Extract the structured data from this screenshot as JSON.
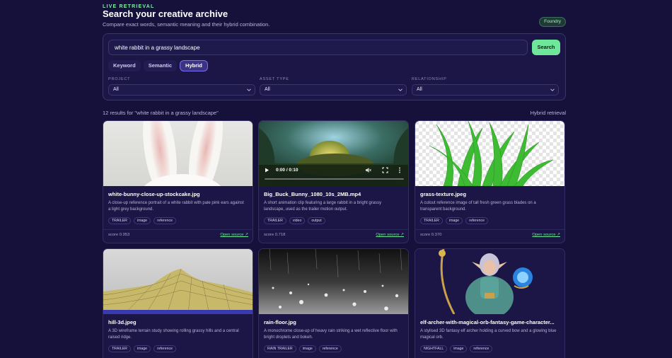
{
  "header": {
    "eyebrow": "LIVE RETRIEVAL",
    "title": "Search your creative archive",
    "subtitle": "Compare exact words, semantic meaning and their hybrid combination.",
    "badge": "Foundry"
  },
  "search": {
    "value": "white rabbit in a grassy landscape",
    "button": "Search"
  },
  "modes": [
    {
      "label": "Keyword",
      "active": false
    },
    {
      "label": "Semantic",
      "active": false
    },
    {
      "label": "Hybrid",
      "active": true
    }
  ],
  "filters": [
    {
      "label": "PROJECT",
      "value": "All"
    },
    {
      "label": "ASSET TYPE",
      "value": "All"
    },
    {
      "label": "RELATIONSHIP",
      "value": "All"
    }
  ],
  "results": {
    "count_text": "12 results for \"white rabbit in a grassy landscape\"",
    "mode_text": "Hybrid retrieval"
  },
  "video": {
    "time": "0:00 / 0:10"
  },
  "cards": [
    {
      "title": "white-bunny-close-up-stockcake.jpg",
      "desc": "A close-up reference portrait of a white rabbit with pale pink ears against a light grey background.",
      "tags": [
        "TRAILER",
        "image",
        "reference"
      ],
      "score": "score 0.953",
      "link": "Open source ↗"
    },
    {
      "title": "Big_Buck_Bunny_1080_10s_2MB.mp4",
      "desc": "A short animation clip featuring a large rabbit in a bright grassy landscape, used as the trailer motion output.",
      "tags": [
        "TRAILER",
        "video",
        "output"
      ],
      "score": "score 0.718",
      "link": "Open source ↗"
    },
    {
      "title": "grass-texture.jpeg",
      "desc": "A cutout reference image of tall fresh green grass blades on a transparent background.",
      "tags": [
        "TRAILER",
        "image",
        "reference"
      ],
      "score": "score 0.370",
      "link": "Open source ↗"
    },
    {
      "title": "hill-3d.jpeg",
      "desc": "A 3D wireframe terrain study showing rolling grassy hills and a central raised ridge.",
      "tags": [
        "TRAILER",
        "image",
        "reference"
      ],
      "score": "",
      "link": ""
    },
    {
      "title": "rain-floor.jpg",
      "desc": "A monochrome close-up of heavy rain striking a wet reflective floor with bright droplets and bokeh.",
      "tags": [
        "RAIN TRAILER",
        "image",
        "reference"
      ],
      "score": "",
      "link": ""
    },
    {
      "title": "elf-archer-with-magical-orb-fantasy-game-character...",
      "desc": "A stylised 3D fantasy elf archer holding a curved bow and a glowing blue magical orb.",
      "tags": [
        "NIGHTFALL",
        "image",
        "reference"
      ],
      "score": "",
      "link": ""
    }
  ]
}
